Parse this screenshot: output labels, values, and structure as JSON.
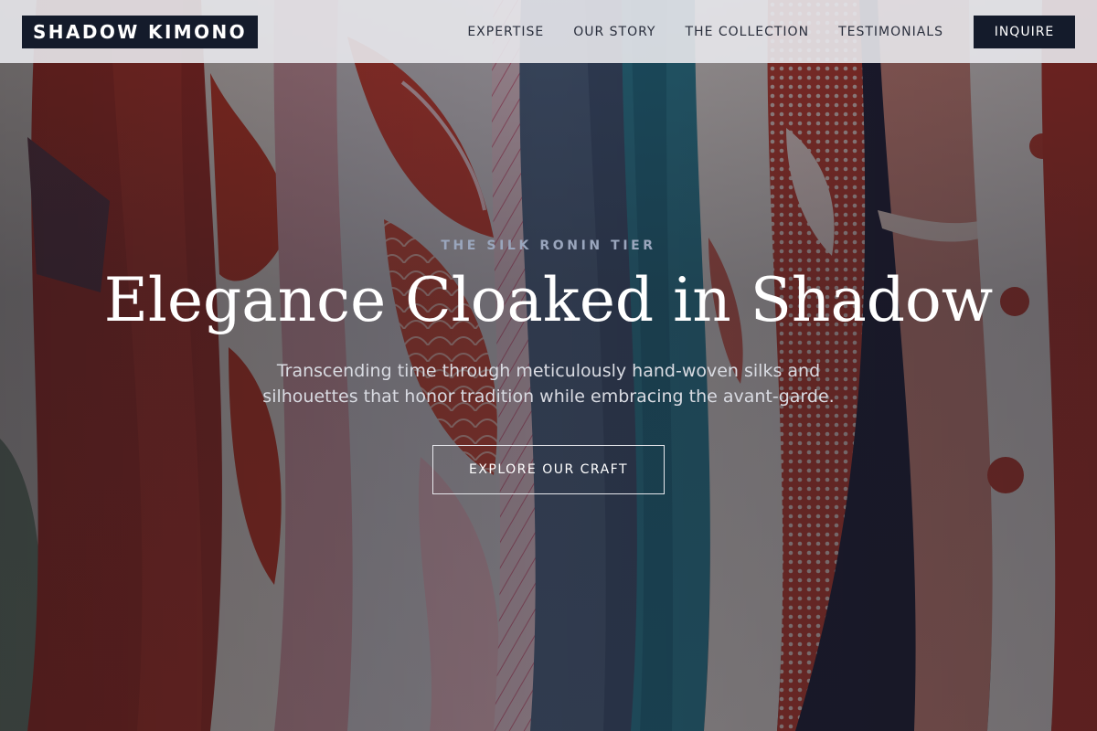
{
  "header": {
    "brand": "SHADOW KIMONO",
    "nav": [
      {
        "label": "EXPERTISE"
      },
      {
        "label": "OUR STORY"
      },
      {
        "label": "THE COLLECTION"
      },
      {
        "label": "TESTIMONIALS"
      }
    ],
    "inquire_label": "INQUIRE"
  },
  "hero": {
    "eyebrow": "THE SILK RONIN TIER",
    "title": "Elegance Cloaked in Shadow",
    "subtitle_line1": "Transcending time through meticulously hand-woven silks and",
    "subtitle_line2": "silhouettes that honor tradition while embracing the avant-garde.",
    "cta_label": "EXPLORE OUR CRAFT"
  },
  "colors": {
    "header_bg": "#e8e8ec",
    "brand_dark": "#141b2b",
    "eyebrow": "#9aa6bd",
    "text_light": "#ffffff"
  }
}
